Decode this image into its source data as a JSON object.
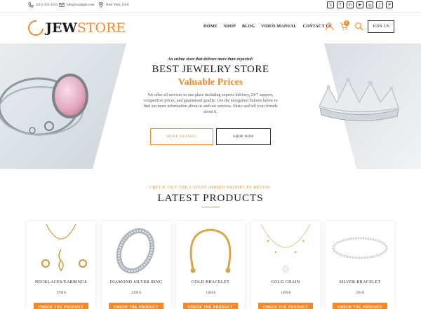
{
  "topbar": {
    "phone": "(111) 333-1234",
    "email": "info@example.com",
    "location": "New York, USA",
    "socials": [
      {
        "icon": "x-icon",
        "glyph": "𝕏"
      },
      {
        "icon": "facebook-icon",
        "glyph": "f"
      },
      {
        "icon": "linkedin-icon",
        "glyph": "in"
      },
      {
        "icon": "youtube-icon",
        "glyph": "▶"
      },
      {
        "icon": "instagram-icon",
        "glyph": "◎"
      },
      {
        "icon": "tiktok-icon",
        "glyph": "♪"
      },
      {
        "icon": "pinterest-icon",
        "glyph": "P"
      }
    ]
  },
  "header": {
    "logo_jew": "JEW",
    "logo_store": "STORE",
    "nav": [
      "HOME",
      "SHOP",
      "BLOG",
      "VIDEO MANUAL",
      "CONTACT US"
    ],
    "cart_count": "0",
    "join_label": "JOIN US"
  },
  "hero": {
    "tagline": "An online store that delivers more than expected!",
    "title": "BEST JEWELRY STORE",
    "subtitle": "Valuable Prices",
    "paragraph": "We offer all services in one place including express delivery, 24/7 support, competitive prices, and guaranteed quality. Use the navigation buttons below to find out more information about us and our services. Share and tell your friends about it.",
    "btn_details": "MORE DETAILS",
    "btn_shop": "SHOP NOW"
  },
  "latest": {
    "kicker": "CHECK OUT THE LATEST ADDED PRODUCTS BELOW.",
    "title": "LATEST PRODUCTS",
    "button_label": "CHECK THE PRODUCT",
    "products": [
      {
        "name": "NECKLACES/EARRINGS",
        "price": "3700 $"
      },
      {
        "name": "DIAMOND SILVER RING",
        "price": "2399 $"
      },
      {
        "name": "GOLD BRACELET",
        "price": "1300 $"
      },
      {
        "name": "GOLD CHAIN",
        "price": "1499 $"
      },
      {
        "name": "SILVER BRACELET",
        "price": "250 $"
      }
    ]
  },
  "colors": {
    "accent": "#f08a2e",
    "text": "#222222"
  }
}
